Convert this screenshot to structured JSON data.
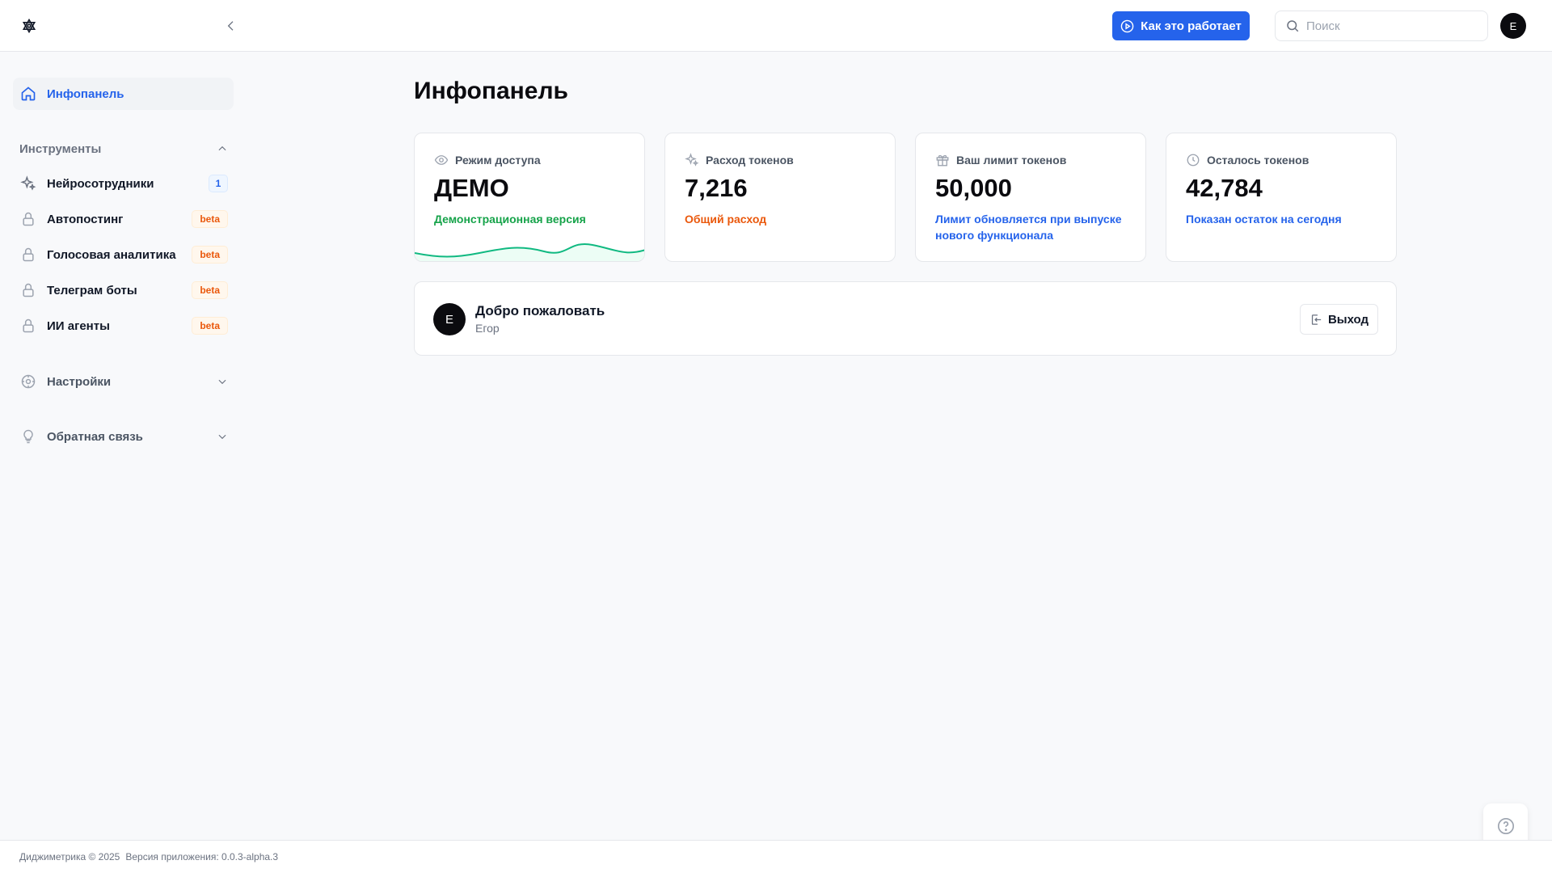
{
  "header": {
    "how_it_works": "Как это работает",
    "search_placeholder": "Поиск",
    "avatar_initial": "E"
  },
  "sidebar": {
    "home": "Инфопанель",
    "tools_heading": "Инструменты",
    "items": [
      {
        "label": "Нейросотрудники",
        "badge": "1"
      },
      {
        "label": "Автопостинг",
        "badge": "beta"
      },
      {
        "label": "Голосовая аналитика",
        "badge": "beta"
      },
      {
        "label": "Телеграм боты",
        "badge": "beta"
      },
      {
        "label": "ИИ агенты",
        "badge": "beta"
      }
    ],
    "settings": "Настройки",
    "feedback": "Обратная связь"
  },
  "main": {
    "title": "Инфопанель",
    "cards": [
      {
        "label": "Режим доступа",
        "value": "ДЕМО",
        "sub": "Демонстрационная версия",
        "sub_color": "#16a34a"
      },
      {
        "label": "Расход токенов",
        "value": "7,216",
        "sub": "Общий расход",
        "sub_color": "#ea580c"
      },
      {
        "label": "Ваш лимит токенов",
        "value": "50,000",
        "sub": "Лимит обновляется при выпуске нового функционала",
        "sub_color": "#2563eb"
      },
      {
        "label": "Осталось токенов",
        "value": "42,784",
        "sub": "Показан остаток на сегодня",
        "sub_color": "#2563eb"
      }
    ],
    "welcome": {
      "avatar_initial": "E",
      "title": "Добро пожаловать",
      "name": "Егор",
      "logout": "Выход"
    }
  },
  "footer": {
    "copyright": "Диджиметрика © 2025",
    "version": "Версия приложения: 0.0.3-alpha.3"
  },
  "colors": {
    "accent": "#2563eb",
    "beta": "#ea580c",
    "success": "#16a34a"
  }
}
